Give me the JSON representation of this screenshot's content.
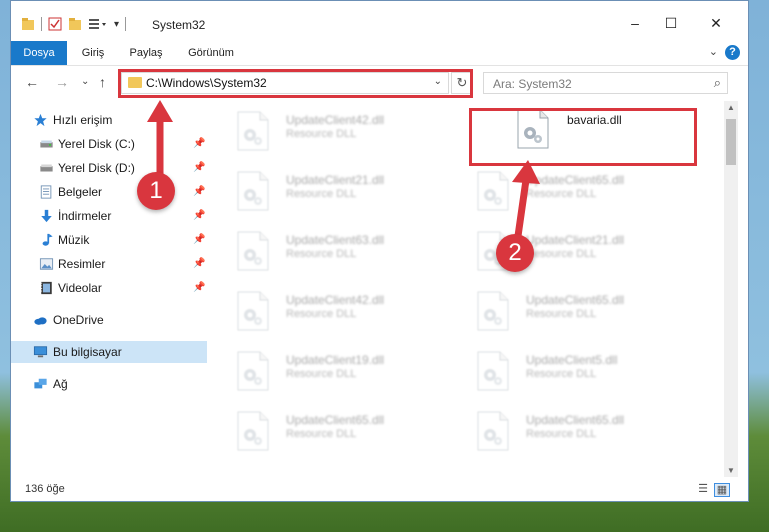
{
  "window": {
    "title": "System32",
    "controls": {
      "minimize": "–",
      "maximize": "☐",
      "close": "✕"
    }
  },
  "ribbon": {
    "tabs": [
      {
        "label": "Dosya"
      },
      {
        "label": "Giriş"
      },
      {
        "label": "Paylaş"
      },
      {
        "label": "Görünüm"
      }
    ],
    "help": "?",
    "collapse": "⌄"
  },
  "nav": {
    "back": "←",
    "forward": "→",
    "recent": "⌄",
    "up": "↑",
    "address": "C:\\Windows\\System32",
    "address_dropdown": "⌄",
    "refresh": "↻",
    "search_placeholder": "Ara: System32",
    "search_icon": "⌕"
  },
  "sidebar": {
    "pin_icon": "📌",
    "quick_access": "Hızlı erişim",
    "items": [
      {
        "label": "Yerel Disk (C:)",
        "icon": "drive-icon",
        "pinned": true
      },
      {
        "label": "Yerel Disk (D:)",
        "icon": "drive-icon",
        "pinned": true
      },
      {
        "label": "Belgeler",
        "icon": "documents-icon",
        "pinned": true
      },
      {
        "label": "İndirmeler",
        "icon": "downloads-icon",
        "pinned": true
      },
      {
        "label": "Müzik",
        "icon": "music-icon",
        "pinned": true
      },
      {
        "label": "Resimler",
        "icon": "pictures-icon",
        "pinned": true
      },
      {
        "label": "Videolar",
        "icon": "videos-icon",
        "pinned": true
      }
    ],
    "onedrive": "OneDrive",
    "this_pc": "Bu bilgisayar",
    "network": "Ağ"
  },
  "files": {
    "left_column": [
      {
        "name": "UpdateClient42.dll",
        "type": "Resource DLL"
      },
      {
        "name": "UpdateClient21.dll",
        "type": "Resource DLL"
      },
      {
        "name": "UpdateClient63.dll",
        "type": "Resource DLL"
      },
      {
        "name": "UpdateClient42.dll",
        "type": "Resource DLL"
      },
      {
        "name": "UpdateClient19.dll",
        "type": "Resource DLL"
      },
      {
        "name": "UpdateClient65.dll",
        "type": "Resource DLL"
      }
    ],
    "right_column": [
      {
        "name": "bavaria.dll",
        "type": ""
      },
      {
        "name": "UpdateClient65.dll",
        "type": "Resource DLL"
      },
      {
        "name": "UpdateClient21.dll",
        "type": "Resource DLL"
      },
      {
        "name": "UpdateClient65.dll",
        "type": "Resource DLL"
      },
      {
        "name": "UpdateClient5.dll",
        "type": "Resource DLL"
      },
      {
        "name": "UpdateClient65.dll",
        "type": "Resource DLL"
      }
    ]
  },
  "status": {
    "item_count": "136 öğe"
  },
  "annotations": {
    "step1": "1",
    "step2": "2"
  },
  "colors": {
    "accent": "#1979ca",
    "annotation": "#d9363e",
    "selection": "#cce4f7"
  }
}
